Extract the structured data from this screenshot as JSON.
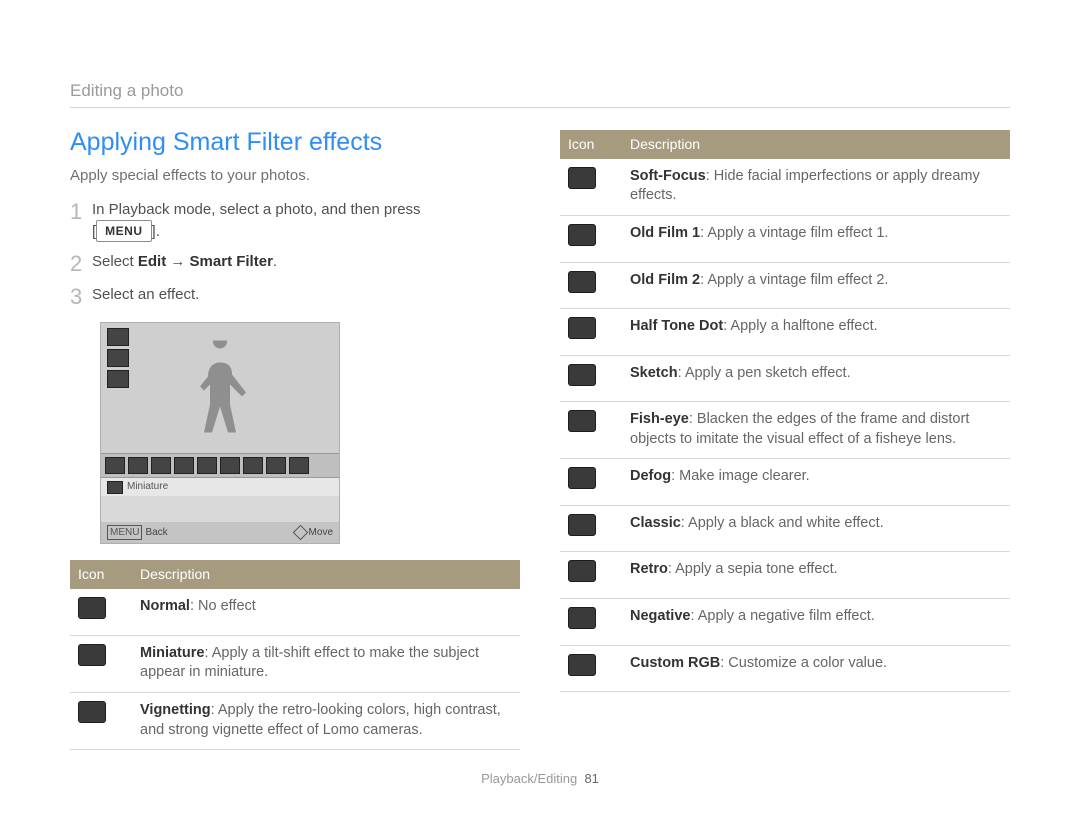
{
  "header": {
    "section": "Editing a photo"
  },
  "title": "Applying Smart Filter effects",
  "intro": "Apply special effects to your photos.",
  "steps": {
    "s1a": "In Playback mode, select a photo, and then press ",
    "s1b": ".",
    "menu_label": "MENU",
    "s2a": "Select ",
    "s2b_edit": "Edit",
    "s2b_arrow": " → ",
    "s2b_sf": "Smart Filter",
    "s2c": ".",
    "s3": "Select an effect."
  },
  "screenshot": {
    "label": "Miniature",
    "back": "Back",
    "move": "Move",
    "menu": "MENU"
  },
  "table_headers": {
    "icon": "Icon",
    "desc": "Description"
  },
  "left_table": [
    {
      "name": "Normal",
      "text": ": No effect"
    },
    {
      "name": "Miniature",
      "text": ": Apply a tilt-shift effect to make the subject appear in miniature."
    },
    {
      "name": "Vignetting",
      "text": ": Apply the retro-looking colors, high contrast, and strong vignette effect of Lomo cameras."
    }
  ],
  "right_table": [
    {
      "name": "Soft-Focus",
      "text": ": Hide facial imperfections or apply dreamy effects."
    },
    {
      "name": "Old Film 1",
      "text": ": Apply a vintage film effect 1."
    },
    {
      "name": "Old Film 2",
      "text": ": Apply a vintage film effect 2."
    },
    {
      "name": "Half Tone Dot",
      "text": ": Apply a halftone effect."
    },
    {
      "name": "Sketch",
      "text": ": Apply a pen sketch effect."
    },
    {
      "name": "Fish-eye",
      "text": ": Blacken the edges of the frame and distort objects to imitate the visual effect of a fisheye lens."
    },
    {
      "name": "Defog",
      "text": ": Make image clearer."
    },
    {
      "name": "Classic",
      "text": ": Apply a black and white effect."
    },
    {
      "name": "Retro",
      "text": ": Apply a sepia tone effect."
    },
    {
      "name": "Negative",
      "text": ": Apply a negative film effect."
    },
    {
      "name": "Custom RGB",
      "text": ": Customize a color value."
    }
  ],
  "footer": {
    "section": "Playback/Editing",
    "page": "81"
  }
}
